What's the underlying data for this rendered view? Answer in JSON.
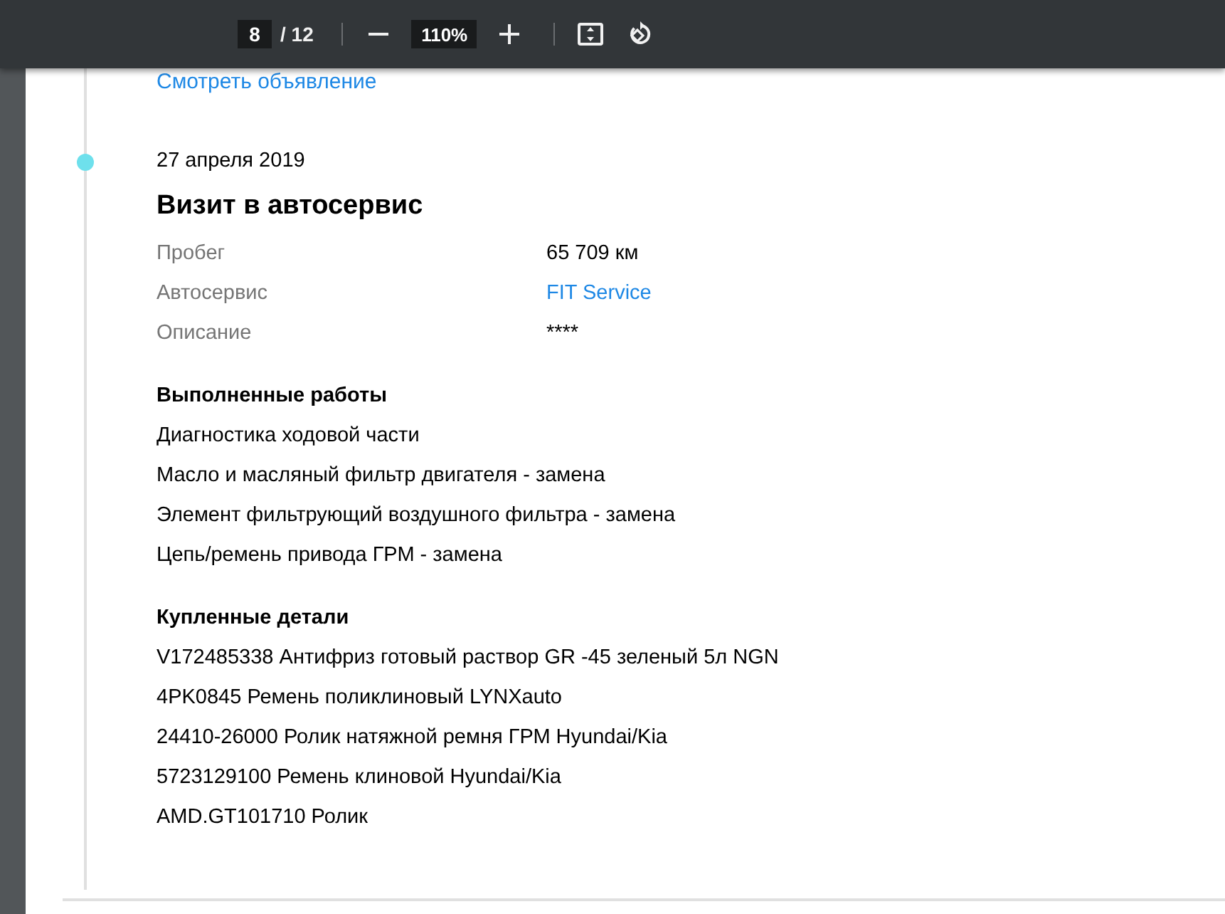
{
  "toolbar": {
    "page": "8",
    "page_count": "/ 12",
    "zoom": "110%"
  },
  "entry": {
    "top_link": "Смотреть объявление",
    "date": "27 апреля 2019",
    "title": "Визит в автосервис",
    "fields": [
      {
        "label": "Пробег",
        "value": "65 709 км",
        "kind": "text"
      },
      {
        "label": "Автосервис",
        "value": "FIT Service",
        "kind": "link"
      },
      {
        "label": "Описание",
        "value": "****",
        "kind": "text"
      }
    ],
    "sections": [
      {
        "heading": "Выполненные работы",
        "items": [
          "Диагностика ходовой части",
          "Масло и масляный фильтр двигателя - замена",
          "Элемент фильтрующий воздушного фильтра - замена",
          "Цепь/ремень привода ГРМ - замена"
        ]
      },
      {
        "heading": "Купленные детали",
        "items": [
          "V172485338 Антифриз готовый раствор GR -45 зеленый 5л NGN",
          "4PK0845 Ремень поликлиновый LYNXauto",
          "24410-26000 Ролик натяжной ремня ГРМ Hyundai/Kia",
          "5723129100 Ремень клиновой Hyundai/Kia",
          "AMD.GT101710 Ролик"
        ]
      }
    ]
  }
}
